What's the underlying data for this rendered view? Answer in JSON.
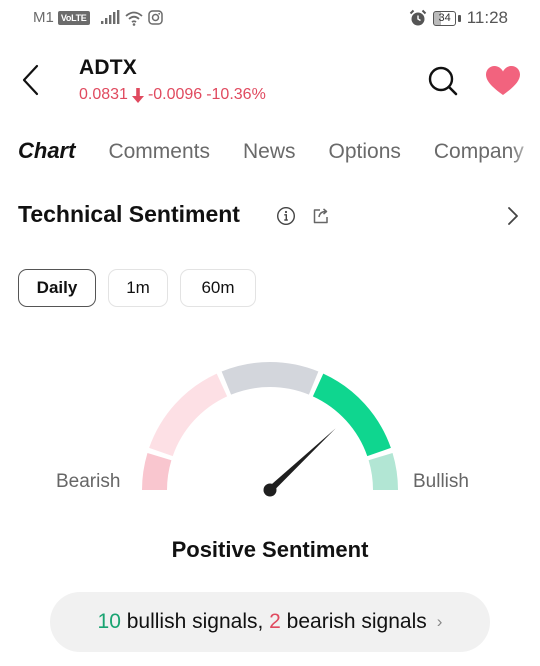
{
  "status_bar": {
    "carrier": "M1",
    "volte_badge": "VoLTE",
    "battery_percent": "34",
    "time": "11:28",
    "icons": [
      "signal-bars-icon",
      "wifi-icon",
      "instagram-icon",
      "alarm-icon",
      "battery-icon"
    ]
  },
  "header": {
    "ticker": "ADTX",
    "price": "0.0831",
    "change": "-0.0096",
    "change_percent": "-10.36%",
    "direction": "down",
    "colors": {
      "negative": "#e04a5f",
      "favorite": "#f2637e"
    }
  },
  "tabs": [
    {
      "label": "Chart",
      "active": true
    },
    {
      "label": "Comments",
      "active": false
    },
    {
      "label": "News",
      "active": false
    },
    {
      "label": "Options",
      "active": false
    },
    {
      "label": "Company",
      "active": false
    }
  ],
  "section": {
    "title": "Technical Sentiment"
  },
  "periods": [
    {
      "label": "Daily",
      "active": true
    },
    {
      "label": "1m",
      "active": false
    },
    {
      "label": "60m",
      "active": false
    }
  ],
  "gauge": {
    "left_label": "Bearish",
    "right_label": "Bullish",
    "segments": [
      {
        "name": "strong-bearish",
        "color": "#f9c6cf"
      },
      {
        "name": "bearish",
        "color": "#fde0e5"
      },
      {
        "name": "neutral",
        "color": "#d3d6dc"
      },
      {
        "name": "bullish",
        "color": "#0fd68f"
      },
      {
        "name": "strong-bullish",
        "color": "#b2e6d4"
      }
    ],
    "segment_boundaries_fraction": [
      0,
      0.1,
      0.37,
      0.63,
      0.9,
      1
    ],
    "needle_fraction": 0.76,
    "verdict": "Positive Sentiment"
  },
  "signals": {
    "bullish_count": "10",
    "bullish_text": " bullish signals, ",
    "bearish_count": "2",
    "bearish_text": " bearish signals",
    "chevron": "›"
  }
}
